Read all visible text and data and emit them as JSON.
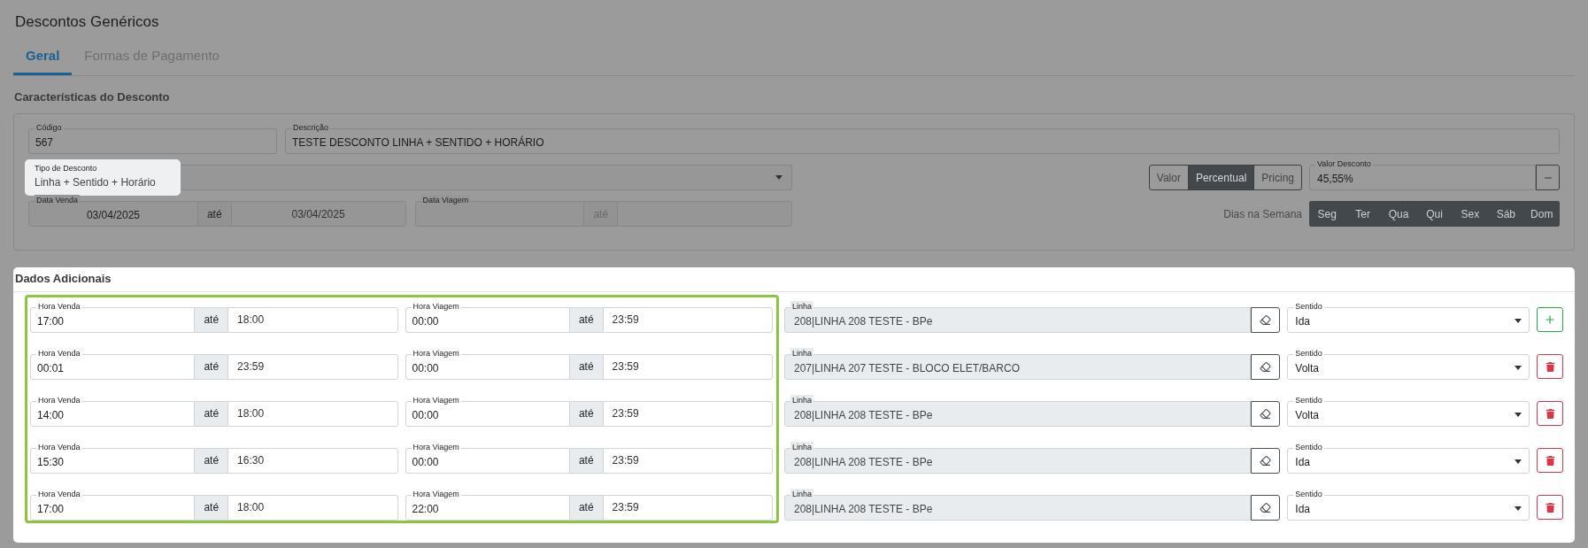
{
  "page_title": "Descontos Genéricos",
  "tabs": [
    {
      "label": "Geral",
      "selected": true
    },
    {
      "label": "Formas de Pagamento",
      "selected": false
    }
  ],
  "characteristics": {
    "heading": "Características do Desconto",
    "codigo": {
      "label": "Código",
      "value": "567"
    },
    "descricao": {
      "label": "Descrição",
      "value": "TESTE DESCONTO LINHA + SENTIDO + HORÁRIO"
    },
    "tipo": {
      "label": "Tipo de Desconto",
      "value": "Linha + Sentido + Horário",
      "highlighted": true
    },
    "value_types": [
      {
        "label": "Valor",
        "selected": false
      },
      {
        "label": "Percentual",
        "selected": true
      },
      {
        "label": "Pricing",
        "selected": false
      }
    ],
    "valor_desconto": {
      "label": "Valor Desconto",
      "value": "45,55%"
    },
    "data_venda": {
      "label": "Data Venda",
      "from": "03/04/2025",
      "separator": "até",
      "to": "03/04/2025",
      "disabled": false
    },
    "data_viagem": {
      "label": "Data Viagem",
      "separator": "até",
      "disabled": true
    },
    "weekdays_label": "Dias na Semana",
    "weekdays": [
      {
        "label": "Seg",
        "selected": true
      },
      {
        "label": "Ter",
        "selected": true
      },
      {
        "label": "Qua",
        "selected": true
      },
      {
        "label": "Qui",
        "selected": true
      },
      {
        "label": "Sex",
        "selected": true
      },
      {
        "label": "Sáb",
        "selected": true
      },
      {
        "label": "Dom",
        "selected": true
      }
    ]
  },
  "additional": {
    "heading": "Dados Adicionais",
    "highlighted": true,
    "rows": [
      {
        "hora_venda": {
          "label": "Hora Venda",
          "from": "17:00",
          "separator": "até",
          "to": "18:00"
        },
        "hora_viagem": {
          "label": "Hora Viagem",
          "from": "00:00",
          "separator": "até",
          "to": "23:59"
        },
        "linha": {
          "label": "Linha",
          "value": "208|LINHA 208 TESTE - BPe"
        },
        "sentido": {
          "label": "Sentido",
          "value": "Ida"
        },
        "kind": "add"
      },
      {
        "hora_venda": {
          "label": "Hora Venda",
          "from": "00:01",
          "separator": "até",
          "to": "23:59"
        },
        "hora_viagem": {
          "label": "Hora Viagem",
          "from": "00:00",
          "separator": "até",
          "to": "23:59"
        },
        "linha": {
          "label": "Linha",
          "value": "207|LINHA 207 TESTE - BLOCO ELET/BARCO"
        },
        "sentido": {
          "label": "Sentido",
          "value": "Volta"
        },
        "kind": "delete"
      },
      {
        "hora_venda": {
          "label": "Hora Venda",
          "from": "14:00",
          "separator": "até",
          "to": "18:00"
        },
        "hora_viagem": {
          "label": "Hora Viagem",
          "from": "00:00",
          "separator": "até",
          "to": "23:59"
        },
        "linha": {
          "label": "Linha",
          "value": "208|LINHA 208 TESTE - BPe"
        },
        "sentido": {
          "label": "Sentido",
          "value": "Volta"
        },
        "kind": "delete"
      },
      {
        "hora_venda": {
          "label": "Hora Venda",
          "from": "15:30",
          "separator": "até",
          "to": "16:30"
        },
        "hora_viagem": {
          "label": "Hora Viagem",
          "from": "00:00",
          "separator": "até",
          "to": "23:59"
        },
        "linha": {
          "label": "Linha",
          "value": "208|LINHA 208 TESTE - BPe"
        },
        "sentido": {
          "label": "Sentido",
          "value": "Ida"
        },
        "kind": "delete"
      },
      {
        "hora_venda": {
          "label": "Hora Venda",
          "from": "17:00",
          "separator": "até",
          "to": "18:00"
        },
        "hora_viagem": {
          "label": "Hora Viagem",
          "from": "22:00",
          "separator": "até",
          "to": "23:59"
        },
        "linha": {
          "label": "Linha",
          "value": "208|LINHA 208 TESTE - BPe"
        },
        "sentido": {
          "label": "Sentido",
          "value": "Ida"
        },
        "kind": "delete"
      }
    ]
  }
}
